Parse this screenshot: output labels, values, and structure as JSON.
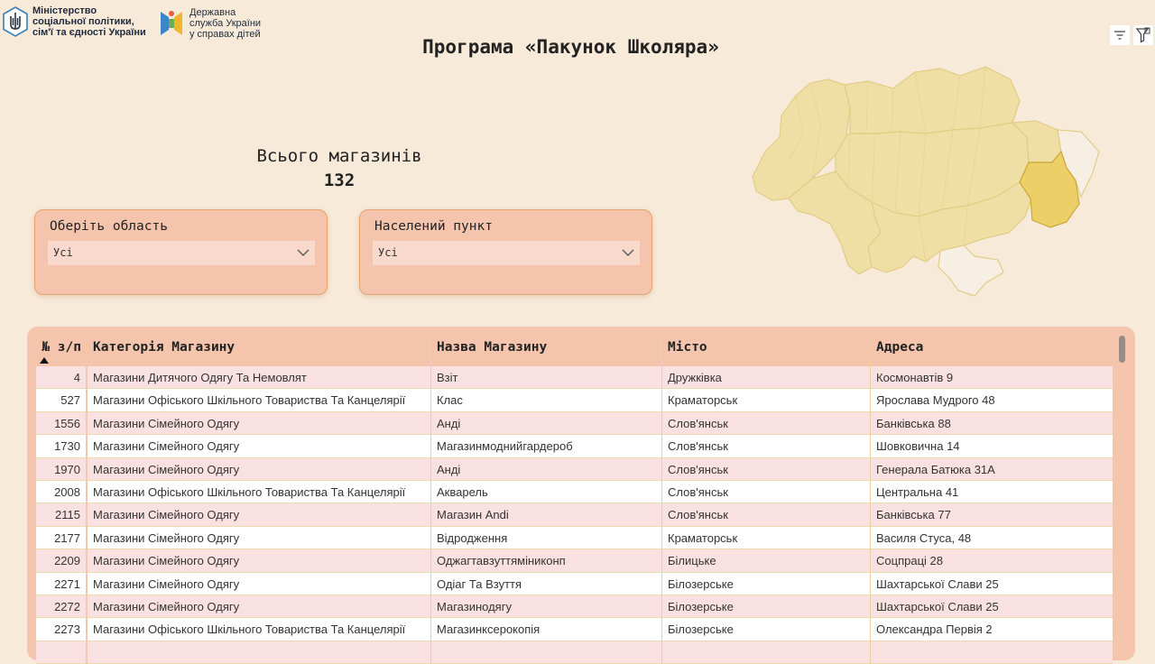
{
  "branding": {
    "ministry_line1": "Міністерство",
    "ministry_line2": "соціальної політики,",
    "ministry_line3": "сім'ї та єдності України",
    "service_line1": "Державна",
    "service_line2": "служба України",
    "service_line3": "у справах дітей"
  },
  "title": "Програма «Пакунок Школяра»",
  "kpi": {
    "label": "Всього магазинів",
    "value": "132"
  },
  "filters": [
    {
      "label": "Оберіть область",
      "value": "Усі"
    },
    {
      "label": "Населений пункт",
      "value": "Усі"
    }
  ],
  "toolbar": {
    "filter_icon": "filter-icon",
    "focus_icon": "filter-pane-icon"
  },
  "map": {
    "highlighted_region_color": "#ecd067",
    "region_color": "#f0dfa4",
    "inactive_color": "#f7efe4",
    "border_color": "#e2cc86"
  },
  "table": {
    "columns": [
      "№ з/п",
      "Категорія Магазину",
      "Назва Магазину",
      "Місто",
      "Адреса"
    ],
    "rows": [
      [
        "4",
        "Магазини Дитячого Одягу Та Немовлят",
        "Взіт",
        "Дружківка",
        "Космонавтів 9"
      ],
      [
        "527",
        "Магазини Офіського Шкільного Товариства Та Канцелярії",
        "Клас",
        "Краматорськ",
        "Ярослава Мудрого 48"
      ],
      [
        "1556",
        "Магазини Сімейного Одягу",
        "Анді",
        "Слов'янськ",
        "Банківська 88"
      ],
      [
        "1730",
        "Магазини Сімейного Одягу",
        "Магазинмоднийгардероб",
        "Слов'янськ",
        "Шовковична 14"
      ],
      [
        "1970",
        "Магазини Сімейного Одягу",
        "Анді",
        "Слов'янськ",
        "Генерала Батюка 31А"
      ],
      [
        "2008",
        "Магазини Офіського Шкільного Товариства Та Канцелярії",
        "Акварель",
        "Слов'янськ",
        "Центральна 41"
      ],
      [
        "2115",
        "Магазини Сімейного Одягу",
        "Магазин Andi",
        "Слов'янськ",
        "Банківська 77"
      ],
      [
        "2177",
        "Магазини Сімейного Одягу",
        "Відродження",
        "Краматорськ",
        "Василя Стуса, 48"
      ],
      [
        "2209",
        "Магазини Сімейного Одягу",
        "Оджагтавзуттяміниконп",
        "Білицьке",
        "Соцпраці 28"
      ],
      [
        "2271",
        "Магазини Сімейного Одягу",
        "Одіаг Та Взуття",
        "Білозерське",
        "Шахтарської Слави 25"
      ],
      [
        "2272",
        "Магазини Сімейного Одягу",
        "Магазинодягу",
        "Білозерське",
        "Шахтарської Слави 25"
      ],
      [
        "2273",
        "Магазини Офіського Шкільного Товариства Та Канцелярії",
        "Магазинксерокопія",
        "Білозерське",
        "Олександра Первія 2"
      ],
      [
        "",
        "",
        "",
        "",
        ""
      ]
    ]
  }
}
